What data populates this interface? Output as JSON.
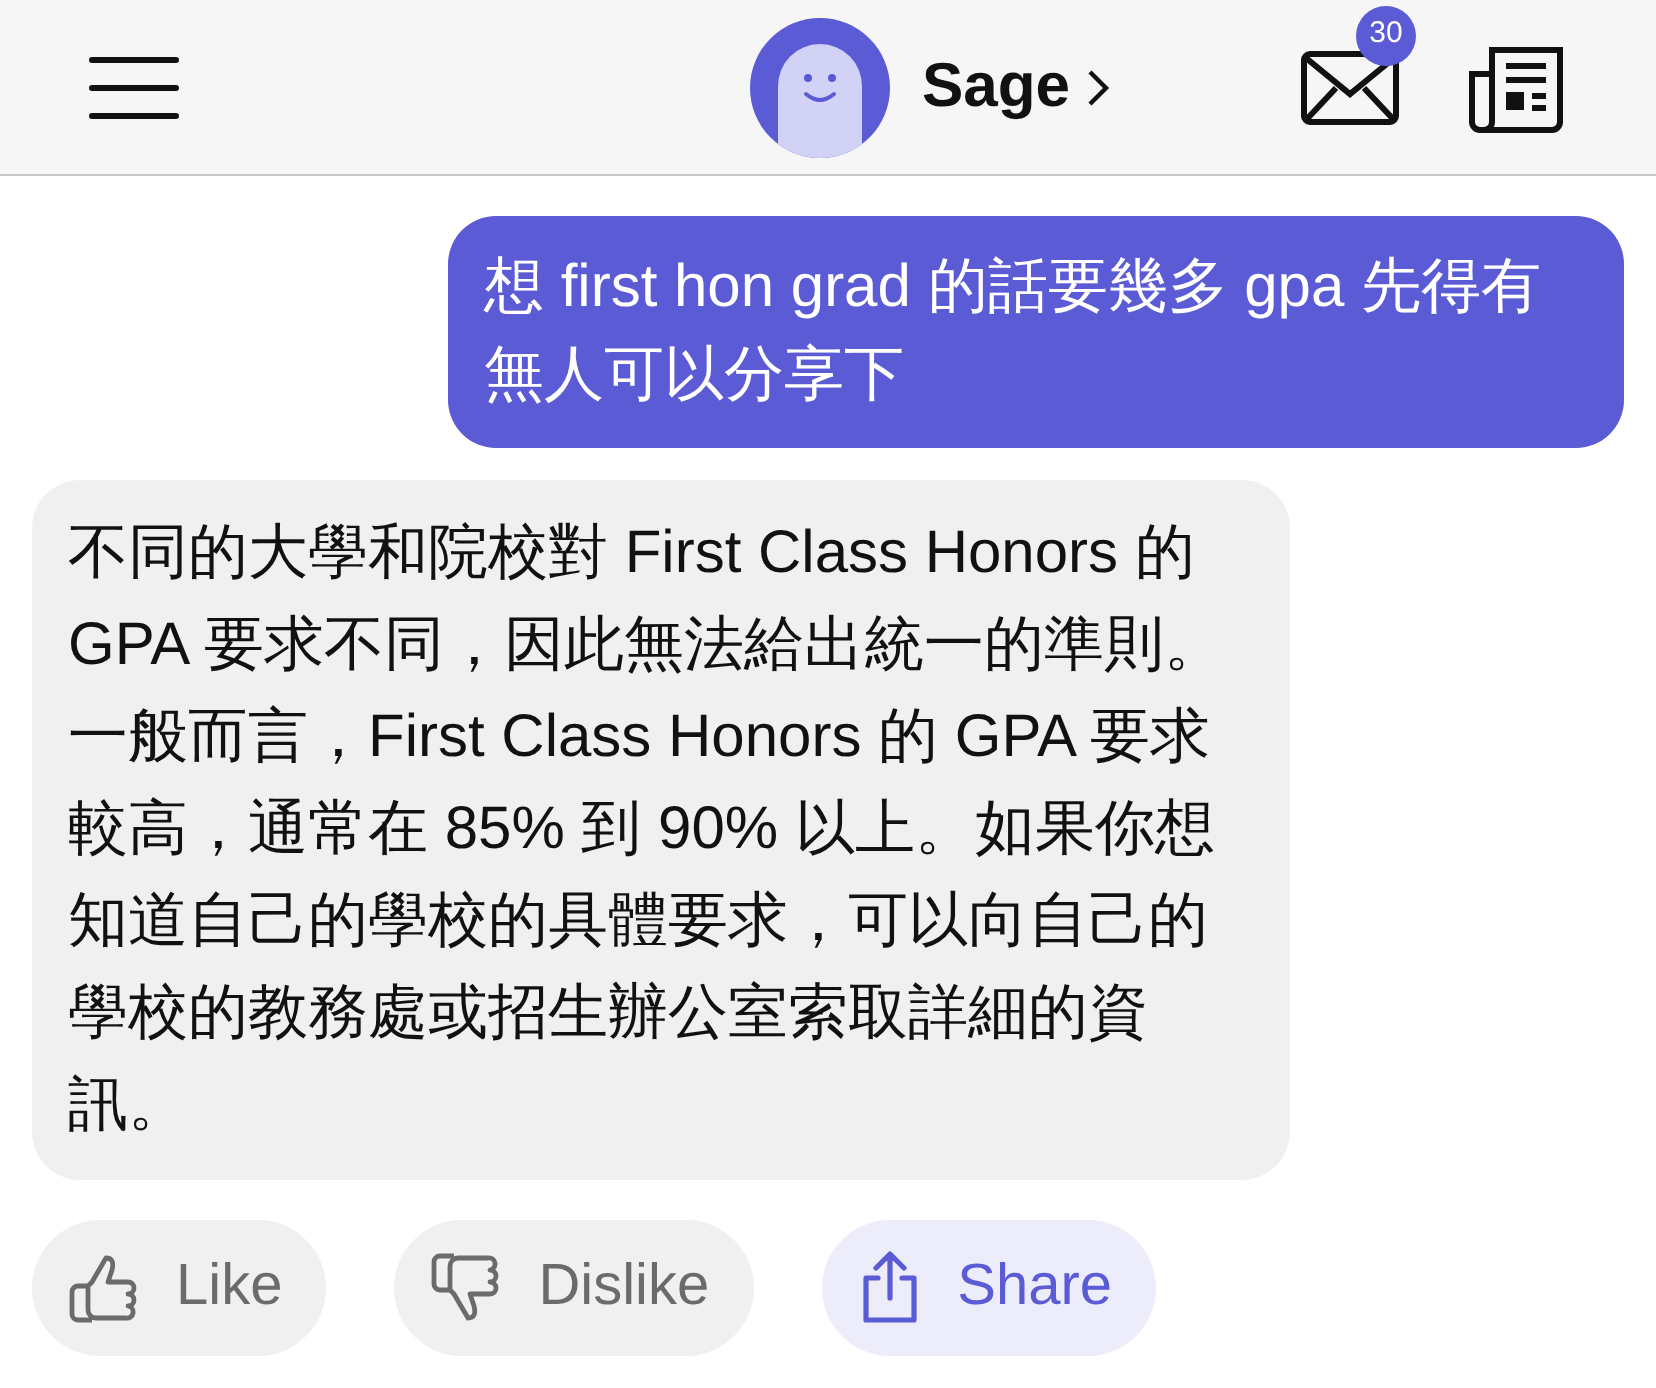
{
  "header": {
    "title": "Sage",
    "unread_count": "30"
  },
  "messages": [
    {
      "kind": "user",
      "text": "想 first hon grad 的話要幾多 gpa 先得有無人可以分享下"
    },
    {
      "kind": "bot",
      "text": "不同的大學和院校對 First Class Honors 的 GPA 要求不同，因此無法給出統一的準則。一般而言，First Class Honors 的 GPA 要求較高，通常在 85% 到 90% 以上。如果你想知道自己的學校的具體要求，可以向自己的學校的教務處或招生辦公室索取詳細的資訊。"
    }
  ],
  "actions": [
    {
      "kind": "like",
      "label": "Like",
      "highlighted": false
    },
    {
      "kind": "dislike",
      "label": "Dislike",
      "highlighted": false
    },
    {
      "kind": "share",
      "label": "Share",
      "highlighted": true
    }
  ]
}
